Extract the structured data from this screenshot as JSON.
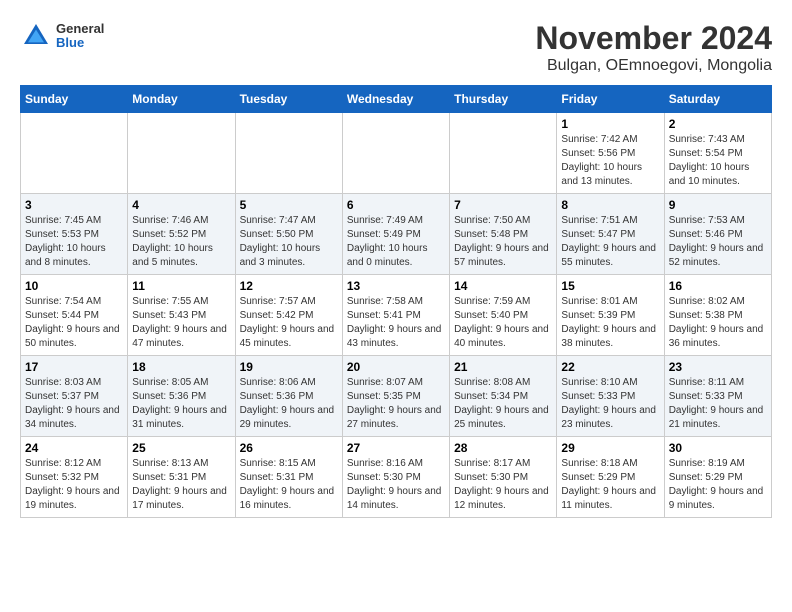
{
  "header": {
    "logo": {
      "general": "General",
      "blue": "Blue"
    },
    "month": "November 2024",
    "location": "Bulgan, OEmnoegovi, Mongolia"
  },
  "weekdays": [
    "Sunday",
    "Monday",
    "Tuesday",
    "Wednesday",
    "Thursday",
    "Friday",
    "Saturday"
  ],
  "weeks": [
    [
      {
        "day": null,
        "sunrise": null,
        "sunset": null,
        "daylight": null
      },
      {
        "day": null,
        "sunrise": null,
        "sunset": null,
        "daylight": null
      },
      {
        "day": null,
        "sunrise": null,
        "sunset": null,
        "daylight": null
      },
      {
        "day": null,
        "sunrise": null,
        "sunset": null,
        "daylight": null
      },
      {
        "day": null,
        "sunrise": null,
        "sunset": null,
        "daylight": null
      },
      {
        "day": "1",
        "sunrise": "Sunrise: 7:42 AM",
        "sunset": "Sunset: 5:56 PM",
        "daylight": "Daylight: 10 hours and 13 minutes."
      },
      {
        "day": "2",
        "sunrise": "Sunrise: 7:43 AM",
        "sunset": "Sunset: 5:54 PM",
        "daylight": "Daylight: 10 hours and 10 minutes."
      }
    ],
    [
      {
        "day": "3",
        "sunrise": "Sunrise: 7:45 AM",
        "sunset": "Sunset: 5:53 PM",
        "daylight": "Daylight: 10 hours and 8 minutes."
      },
      {
        "day": "4",
        "sunrise": "Sunrise: 7:46 AM",
        "sunset": "Sunset: 5:52 PM",
        "daylight": "Daylight: 10 hours and 5 minutes."
      },
      {
        "day": "5",
        "sunrise": "Sunrise: 7:47 AM",
        "sunset": "Sunset: 5:50 PM",
        "daylight": "Daylight: 10 hours and 3 minutes."
      },
      {
        "day": "6",
        "sunrise": "Sunrise: 7:49 AM",
        "sunset": "Sunset: 5:49 PM",
        "daylight": "Daylight: 10 hours and 0 minutes."
      },
      {
        "day": "7",
        "sunrise": "Sunrise: 7:50 AM",
        "sunset": "Sunset: 5:48 PM",
        "daylight": "Daylight: 9 hours and 57 minutes."
      },
      {
        "day": "8",
        "sunrise": "Sunrise: 7:51 AM",
        "sunset": "Sunset: 5:47 PM",
        "daylight": "Daylight: 9 hours and 55 minutes."
      },
      {
        "day": "9",
        "sunrise": "Sunrise: 7:53 AM",
        "sunset": "Sunset: 5:46 PM",
        "daylight": "Daylight: 9 hours and 52 minutes."
      }
    ],
    [
      {
        "day": "10",
        "sunrise": "Sunrise: 7:54 AM",
        "sunset": "Sunset: 5:44 PM",
        "daylight": "Daylight: 9 hours and 50 minutes."
      },
      {
        "day": "11",
        "sunrise": "Sunrise: 7:55 AM",
        "sunset": "Sunset: 5:43 PM",
        "daylight": "Daylight: 9 hours and 47 minutes."
      },
      {
        "day": "12",
        "sunrise": "Sunrise: 7:57 AM",
        "sunset": "Sunset: 5:42 PM",
        "daylight": "Daylight: 9 hours and 45 minutes."
      },
      {
        "day": "13",
        "sunrise": "Sunrise: 7:58 AM",
        "sunset": "Sunset: 5:41 PM",
        "daylight": "Daylight: 9 hours and 43 minutes."
      },
      {
        "day": "14",
        "sunrise": "Sunrise: 7:59 AM",
        "sunset": "Sunset: 5:40 PM",
        "daylight": "Daylight: 9 hours and 40 minutes."
      },
      {
        "day": "15",
        "sunrise": "Sunrise: 8:01 AM",
        "sunset": "Sunset: 5:39 PM",
        "daylight": "Daylight: 9 hours and 38 minutes."
      },
      {
        "day": "16",
        "sunrise": "Sunrise: 8:02 AM",
        "sunset": "Sunset: 5:38 PM",
        "daylight": "Daylight: 9 hours and 36 minutes."
      }
    ],
    [
      {
        "day": "17",
        "sunrise": "Sunrise: 8:03 AM",
        "sunset": "Sunset: 5:37 PM",
        "daylight": "Daylight: 9 hours and 34 minutes."
      },
      {
        "day": "18",
        "sunrise": "Sunrise: 8:05 AM",
        "sunset": "Sunset: 5:36 PM",
        "daylight": "Daylight: 9 hours and 31 minutes."
      },
      {
        "day": "19",
        "sunrise": "Sunrise: 8:06 AM",
        "sunset": "Sunset: 5:36 PM",
        "daylight": "Daylight: 9 hours and 29 minutes."
      },
      {
        "day": "20",
        "sunrise": "Sunrise: 8:07 AM",
        "sunset": "Sunset: 5:35 PM",
        "daylight": "Daylight: 9 hours and 27 minutes."
      },
      {
        "day": "21",
        "sunrise": "Sunrise: 8:08 AM",
        "sunset": "Sunset: 5:34 PM",
        "daylight": "Daylight: 9 hours and 25 minutes."
      },
      {
        "day": "22",
        "sunrise": "Sunrise: 8:10 AM",
        "sunset": "Sunset: 5:33 PM",
        "daylight": "Daylight: 9 hours and 23 minutes."
      },
      {
        "day": "23",
        "sunrise": "Sunrise: 8:11 AM",
        "sunset": "Sunset: 5:33 PM",
        "daylight": "Daylight: 9 hours and 21 minutes."
      }
    ],
    [
      {
        "day": "24",
        "sunrise": "Sunrise: 8:12 AM",
        "sunset": "Sunset: 5:32 PM",
        "daylight": "Daylight: 9 hours and 19 minutes."
      },
      {
        "day": "25",
        "sunrise": "Sunrise: 8:13 AM",
        "sunset": "Sunset: 5:31 PM",
        "daylight": "Daylight: 9 hours and 17 minutes."
      },
      {
        "day": "26",
        "sunrise": "Sunrise: 8:15 AM",
        "sunset": "Sunset: 5:31 PM",
        "daylight": "Daylight: 9 hours and 16 minutes."
      },
      {
        "day": "27",
        "sunrise": "Sunrise: 8:16 AM",
        "sunset": "Sunset: 5:30 PM",
        "daylight": "Daylight: 9 hours and 14 minutes."
      },
      {
        "day": "28",
        "sunrise": "Sunrise: 8:17 AM",
        "sunset": "Sunset: 5:30 PM",
        "daylight": "Daylight: 9 hours and 12 minutes."
      },
      {
        "day": "29",
        "sunrise": "Sunrise: 8:18 AM",
        "sunset": "Sunset: 5:29 PM",
        "daylight": "Daylight: 9 hours and 11 minutes."
      },
      {
        "day": "30",
        "sunrise": "Sunrise: 8:19 AM",
        "sunset": "Sunset: 5:29 PM",
        "daylight": "Daylight: 9 hours and 9 minutes."
      }
    ]
  ]
}
